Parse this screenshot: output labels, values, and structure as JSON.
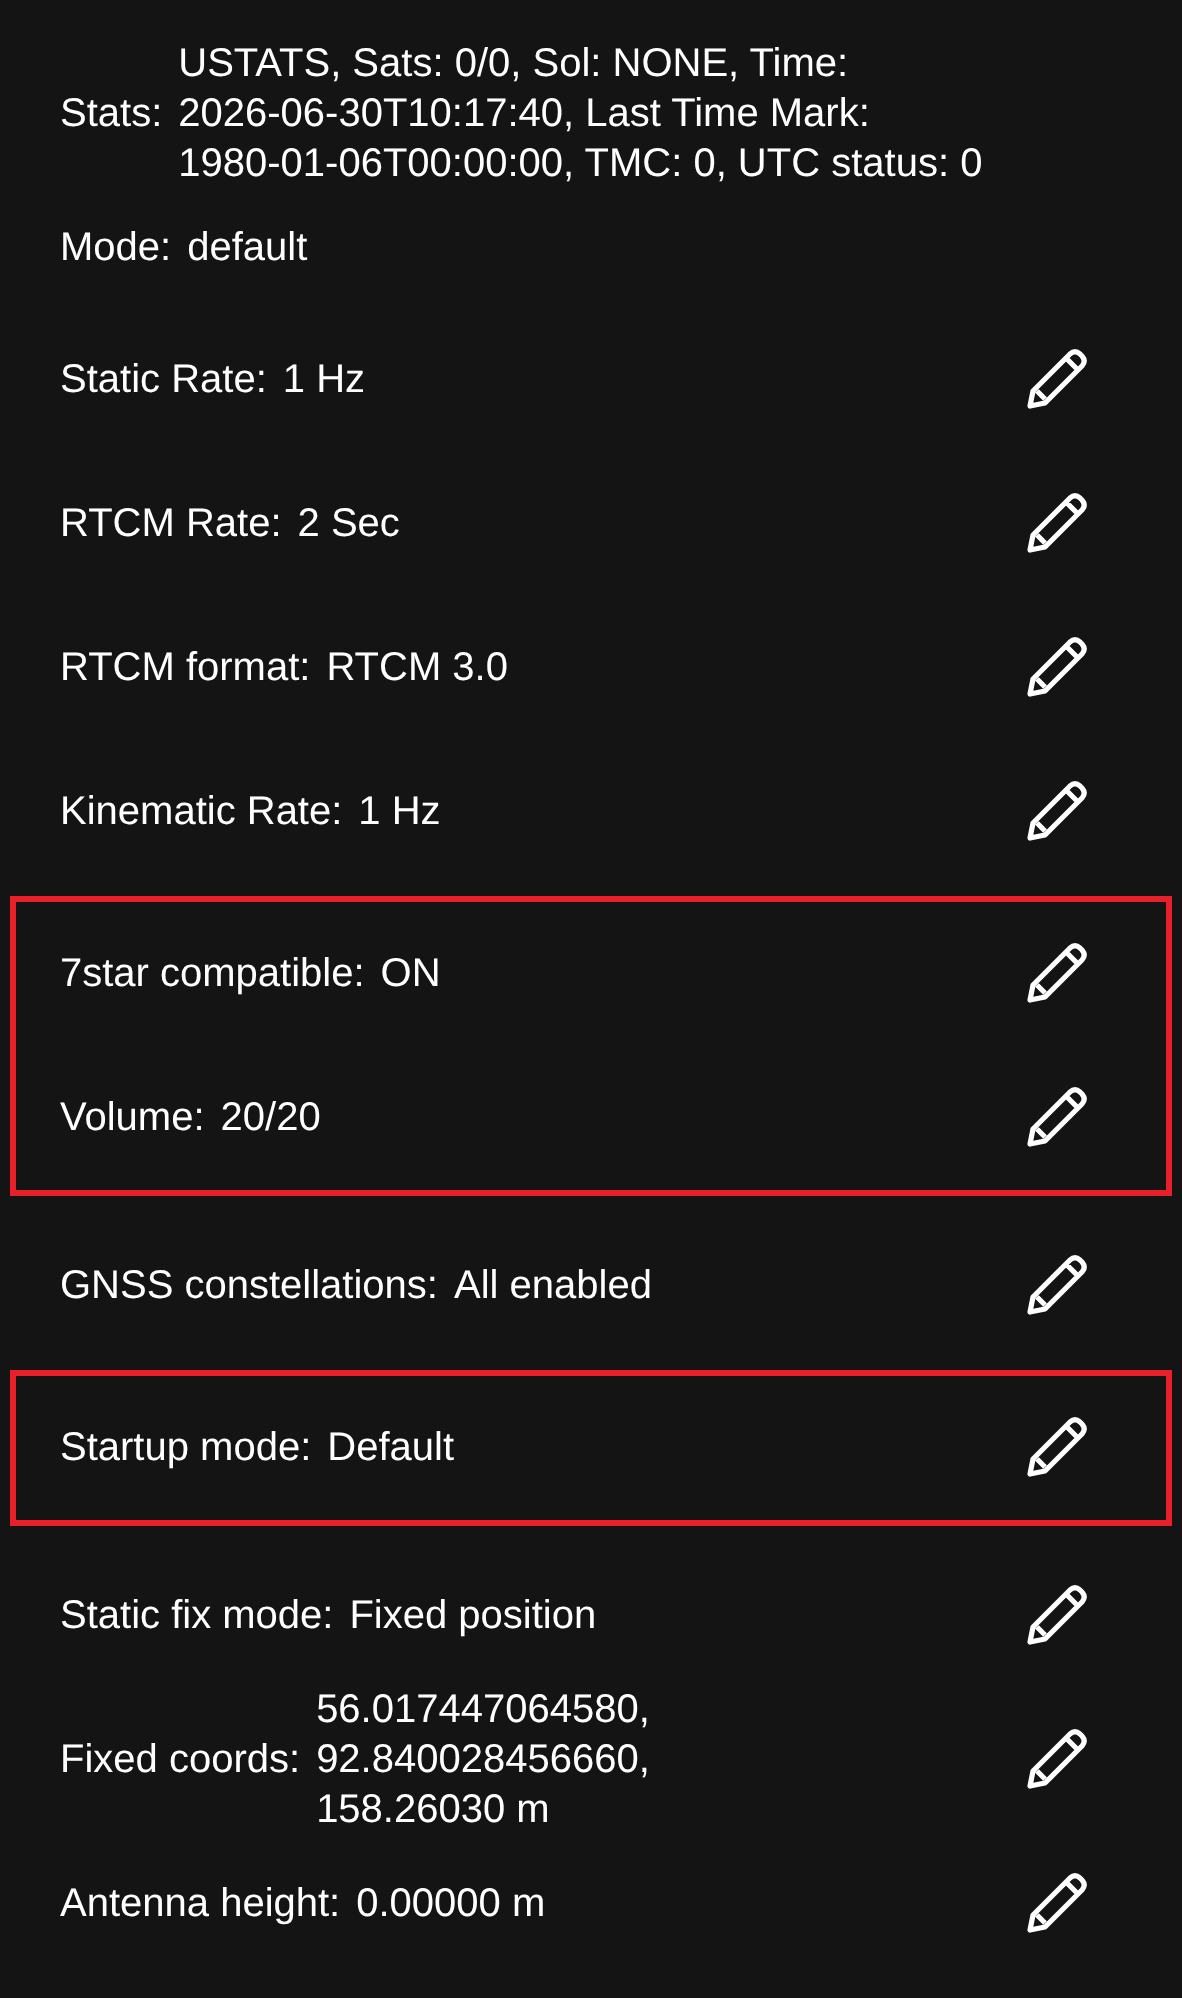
{
  "groups": [
    {
      "highlighted": false,
      "rows": [
        {
          "label": "Stats:",
          "value_lines": [
            "USTATS, Sats: 0/0, Sol: NONE, Time:",
            "2026-06-30T10:17:40, Last Time Mark:",
            "1980-01-06T00:00:00, TMC: 0, UTC status: 0"
          ],
          "editable": false
        },
        {
          "label": "Mode:",
          "value_lines": [
            "default"
          ],
          "editable": false
        },
        {
          "label": "Static Rate:",
          "value_lines": [
            "1 Hz"
          ],
          "editable": true
        },
        {
          "label": "RTCM Rate:",
          "value_lines": [
            "2 Sec"
          ],
          "editable": true
        },
        {
          "label": "RTCM format:",
          "value_lines": [
            "RTCM 3.0"
          ],
          "editable": true
        },
        {
          "label": "Kinematic Rate:",
          "value_lines": [
            "1 Hz"
          ],
          "editable": true
        }
      ]
    },
    {
      "highlighted": true,
      "rows": [
        {
          "label": "7star compatible:",
          "value_lines": [
            "ON"
          ],
          "editable": true
        },
        {
          "label": "Volume:",
          "value_lines": [
            "20/20"
          ],
          "editable": true
        }
      ]
    },
    {
      "highlighted": false,
      "rows": [
        {
          "label": "GNSS constellations:",
          "value_lines": [
            "All enabled"
          ],
          "editable": true
        }
      ]
    },
    {
      "highlighted": true,
      "rows": [
        {
          "label": "Startup mode:",
          "value_lines": [
            "Default"
          ],
          "editable": true
        }
      ]
    },
    {
      "highlighted": false,
      "rows": [
        {
          "label": "Static fix mode:",
          "value_lines": [
            "Fixed position"
          ],
          "editable": true
        },
        {
          "label": "Fixed coords:",
          "value_lines": [
            "56.017447064580,",
            "92.840028456660,",
            "158.26030 m"
          ],
          "editable": true
        },
        {
          "label": "Antenna height:",
          "value_lines": [
            "0.00000 m"
          ],
          "editable": true
        }
      ]
    }
  ]
}
